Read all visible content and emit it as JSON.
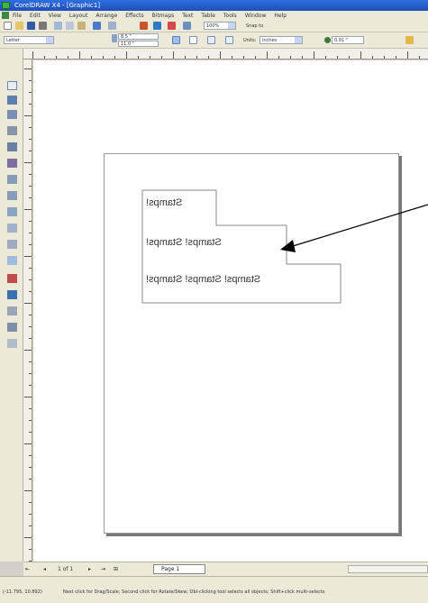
{
  "window": {
    "title": "CorelDRAW X4 - [Graphic1]"
  },
  "menu": [
    "File",
    "Edit",
    "View",
    "Layout",
    "Arrange",
    "Effects",
    "Bitmaps",
    "Text",
    "Table",
    "Tools",
    "Window",
    "Help"
  ],
  "toolbar": {
    "zoom_value": "100%",
    "snap_label": "Snap to",
    "paper_type": "Letter",
    "width_value": "8.5 \"",
    "height_value": "11.0 \"",
    "units_label": "Units:",
    "units_value": "inches",
    "nudge_value": "0.01 \""
  },
  "canvas": {
    "stamp_rows": [
      "Stamps!",
      "Stamps! Stamps!",
      "Stamps! Stamps! Stamps!"
    ]
  },
  "navigator": {
    "page_count": "1 of 1",
    "page_tab": "Page 1"
  },
  "status": {
    "coords": "(-11.795, 10.892)",
    "hint": "Next click for Drag/Scale; Second click for Rotate/Skew; Dbl-clicking tool selects all objects; Shift+click multi-selects"
  },
  "colors": {
    "title_bar": "#2d6fe0",
    "chrome": "#ece9d8",
    "arrow": "#000000"
  }
}
